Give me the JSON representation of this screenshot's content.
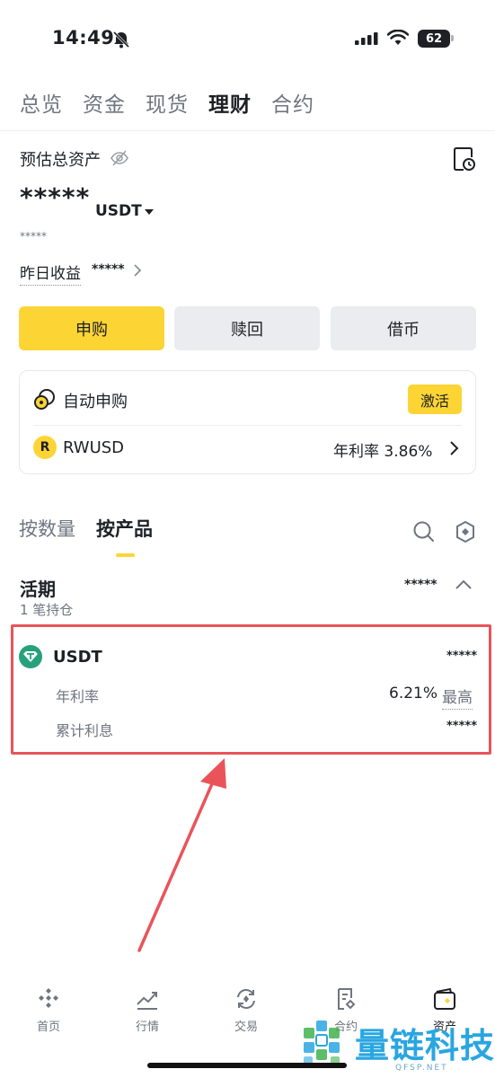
{
  "status": {
    "time": "14:49",
    "battery": "62"
  },
  "top_tabs": [
    {
      "label": "总览"
    },
    {
      "label": "资金"
    },
    {
      "label": "现货"
    },
    {
      "label": "理财",
      "active": true
    },
    {
      "label": "合约"
    }
  ],
  "assets": {
    "label": "预估总资产",
    "total_masked": "*****",
    "unit": "USDT",
    "sub_masked": "*****",
    "yesterday_label": "昨日收益",
    "yesterday_masked": "*****"
  },
  "actions": {
    "subscribe": "申购",
    "redeem": "赎回",
    "borrow": "借币"
  },
  "auto_subscribe": {
    "title": "自动申购",
    "activate": "激活",
    "coin": "RWUSD",
    "apr_label_value": "年利率 3.86%"
  },
  "product_tabs": {
    "by_quantity": "按数量",
    "by_product": "按产品"
  },
  "flexible": {
    "title": "活期",
    "count": "1 笔持仓",
    "total_masked": "*****",
    "item": {
      "coin": "USDT",
      "amount_masked": "*****",
      "apr_label": "年利率",
      "apr_value": "6.21%",
      "apr_max": "最高",
      "interest_label": "累计利息",
      "interest_masked": "*****"
    }
  },
  "bottom_nav": [
    {
      "label": "首页"
    },
    {
      "label": "行情"
    },
    {
      "label": "交易"
    },
    {
      "label": "合约"
    },
    {
      "label": "资产",
      "active": true
    }
  ],
  "watermark": {
    "text": "量链科技",
    "sub": "QFSP.NET"
  },
  "colors": {
    "accent": "#fcd535",
    "highlight": "#e9545a",
    "tether": "#26a17b"
  }
}
